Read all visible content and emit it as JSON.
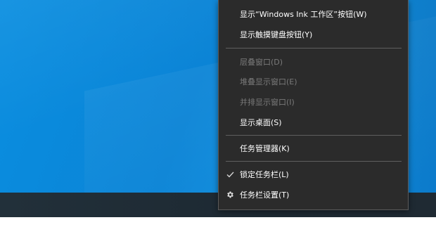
{
  "context_menu": {
    "items": [
      {
        "label": "显示“Windows Ink 工作区”按钮(W)",
        "enabled": true
      },
      {
        "label": "显示触摸键盘按钮(Y)",
        "enabled": true
      },
      {
        "label": "层叠窗口(D)",
        "enabled": false
      },
      {
        "label": "堆叠显示窗口(E)",
        "enabled": false
      },
      {
        "label": "并排显示窗口(I)",
        "enabled": false
      },
      {
        "label": "显示桌面(S)",
        "enabled": true
      },
      {
        "label": "任务管理器(K)",
        "enabled": true
      },
      {
        "label": "锁定任务栏(L)",
        "enabled": true,
        "checked": true,
        "icon": "checkmark-icon"
      },
      {
        "label": "任务栏设置(T)",
        "enabled": true,
        "icon": "gear-icon"
      }
    ]
  },
  "colors": {
    "menu_bg": "#2b2b2b",
    "menu_text": "#ffffff",
    "menu_text_disabled": "#7a7a7a",
    "desktop_blue": "#0b84d6",
    "taskbar": "#1f2a33"
  }
}
